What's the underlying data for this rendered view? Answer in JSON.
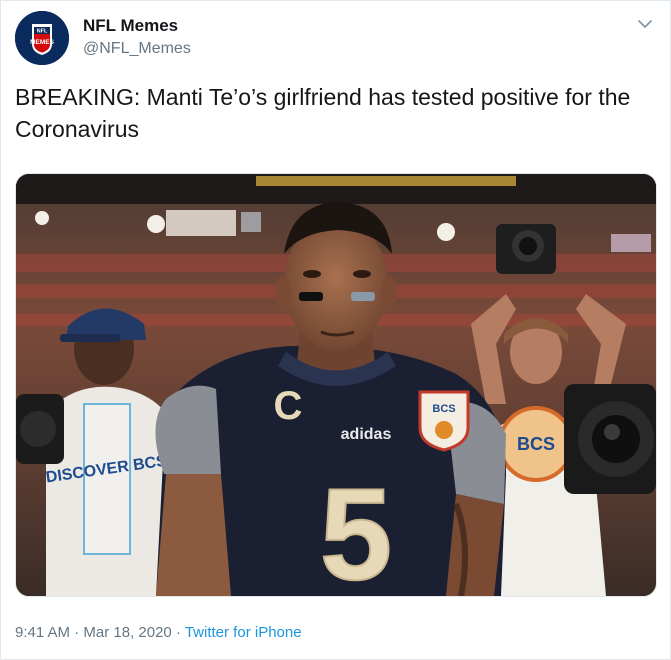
{
  "account": {
    "display_name": "NFL Memes",
    "handle": "@NFL_Memes",
    "avatar_text_top": "NFL",
    "avatar_text_main": "MEMES"
  },
  "tweet": {
    "text": "BREAKING: Manti Te’o’s girlfriend has tested positive for the Coronavirus"
  },
  "media": {
    "jersey_letter": "C",
    "jersey_number": "5",
    "brand": "adidas",
    "patch_text": "BCS",
    "lanyard_text": "DISCOVER BCS",
    "bib_text": "BCS"
  },
  "meta": {
    "time": "9:41 AM",
    "separator": " · ",
    "date": "Mar 18, 2020",
    "source": "Twitter for iPhone"
  },
  "colors": {
    "link": "#1b95e0",
    "muted": "#657786",
    "text": "#14171a"
  }
}
